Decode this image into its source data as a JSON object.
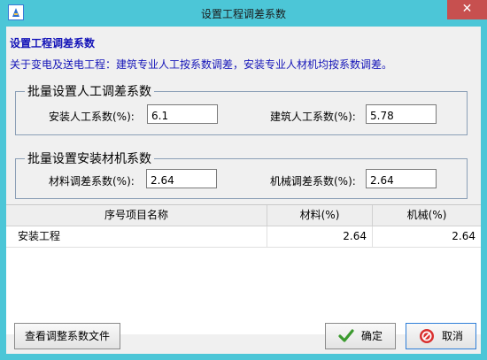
{
  "window": {
    "title": "设置工程调差系数",
    "close_glyph": "✕"
  },
  "header": {
    "heading": "设置工程调差系数",
    "description": "关于变电及送电工程：建筑专业人工按系数调差，安装专业人材机均按系数调差。"
  },
  "labor_group": {
    "legend": "批量设置人工调差系数",
    "install_label": "安装人工系数(%):",
    "install_value": "6.1",
    "build_label": "建筑人工系数(%):",
    "build_value": "5.78"
  },
  "material_group": {
    "legend": "批量设置安装材机系数",
    "material_label": "材料调差系数(%):",
    "material_value": "2.64",
    "machine_label": "机械调差系数(%):",
    "machine_value": "2.64"
  },
  "grid": {
    "columns": [
      "序号项目名称",
      "材料(%)",
      "机械(%)"
    ],
    "rows": [
      {
        "name": "安装工程",
        "material": "2.64",
        "machine": "2.64"
      }
    ]
  },
  "footer": {
    "view_file_label": "查看调整系数文件",
    "ok_label": "确定",
    "cancel_label": "取消"
  },
  "icons": {
    "ok": "check-icon",
    "cancel": "cancel-icon",
    "app": "app-icon"
  },
  "colors": {
    "titlebar": "#4cc6d7",
    "accent_text": "#1414b8",
    "close": "#c7504f"
  }
}
